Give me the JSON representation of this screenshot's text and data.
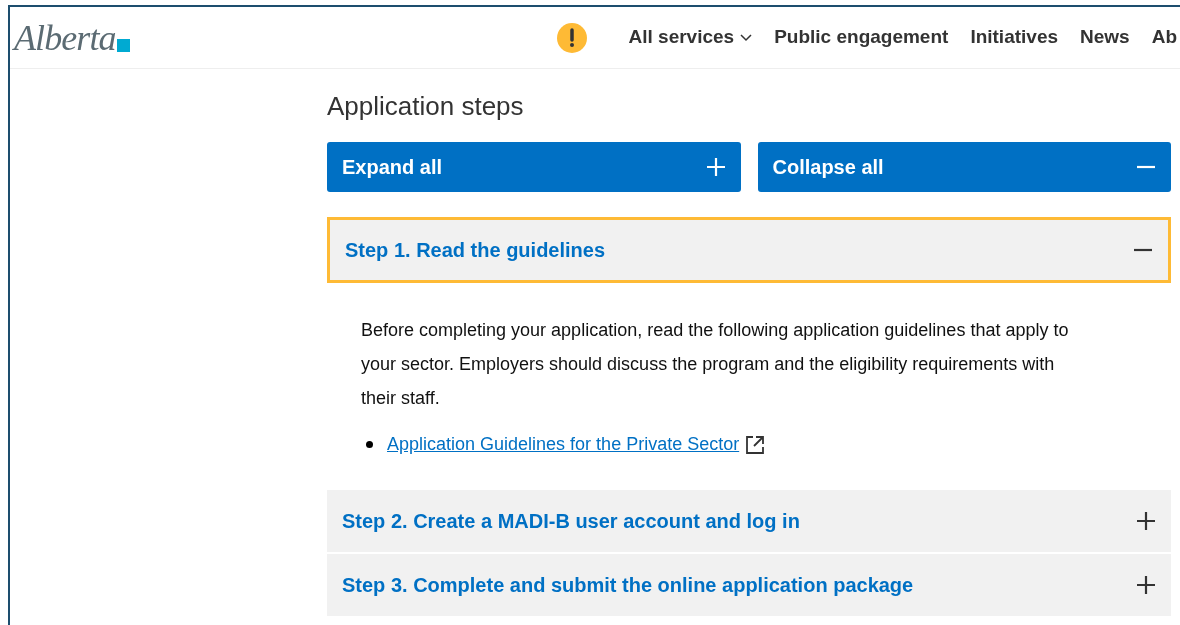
{
  "header": {
    "logo": "Alberta",
    "nav": [
      {
        "label": "All services",
        "dropdown": true
      },
      {
        "label": "Public engagement",
        "dropdown": false
      },
      {
        "label": "Initiatives",
        "dropdown": false
      },
      {
        "label": "News",
        "dropdown": false
      },
      {
        "label": "Ab",
        "dropdown": false
      }
    ]
  },
  "section": {
    "title": "Application steps",
    "buttons": [
      {
        "label": "Expand all",
        "kind": "expand"
      },
      {
        "label": "Collapse all",
        "kind": "collapse"
      }
    ],
    "steps": [
      {
        "title": "Step 1. Read the guidelines",
        "expanded": true,
        "focused": true,
        "body": "Before completing your application, read the following application guidelines that apply to your sector. Employers should discuss the program and the eligibility requirements with their staff.",
        "links": [
          "Application Guidelines for the Private Sector"
        ]
      },
      {
        "title": "Step 2. Create a MADI-B user account and log in",
        "expanded": false,
        "focused": false
      },
      {
        "title": "Step 3. Complete and submit the online application package",
        "expanded": false,
        "focused": false
      }
    ]
  }
}
